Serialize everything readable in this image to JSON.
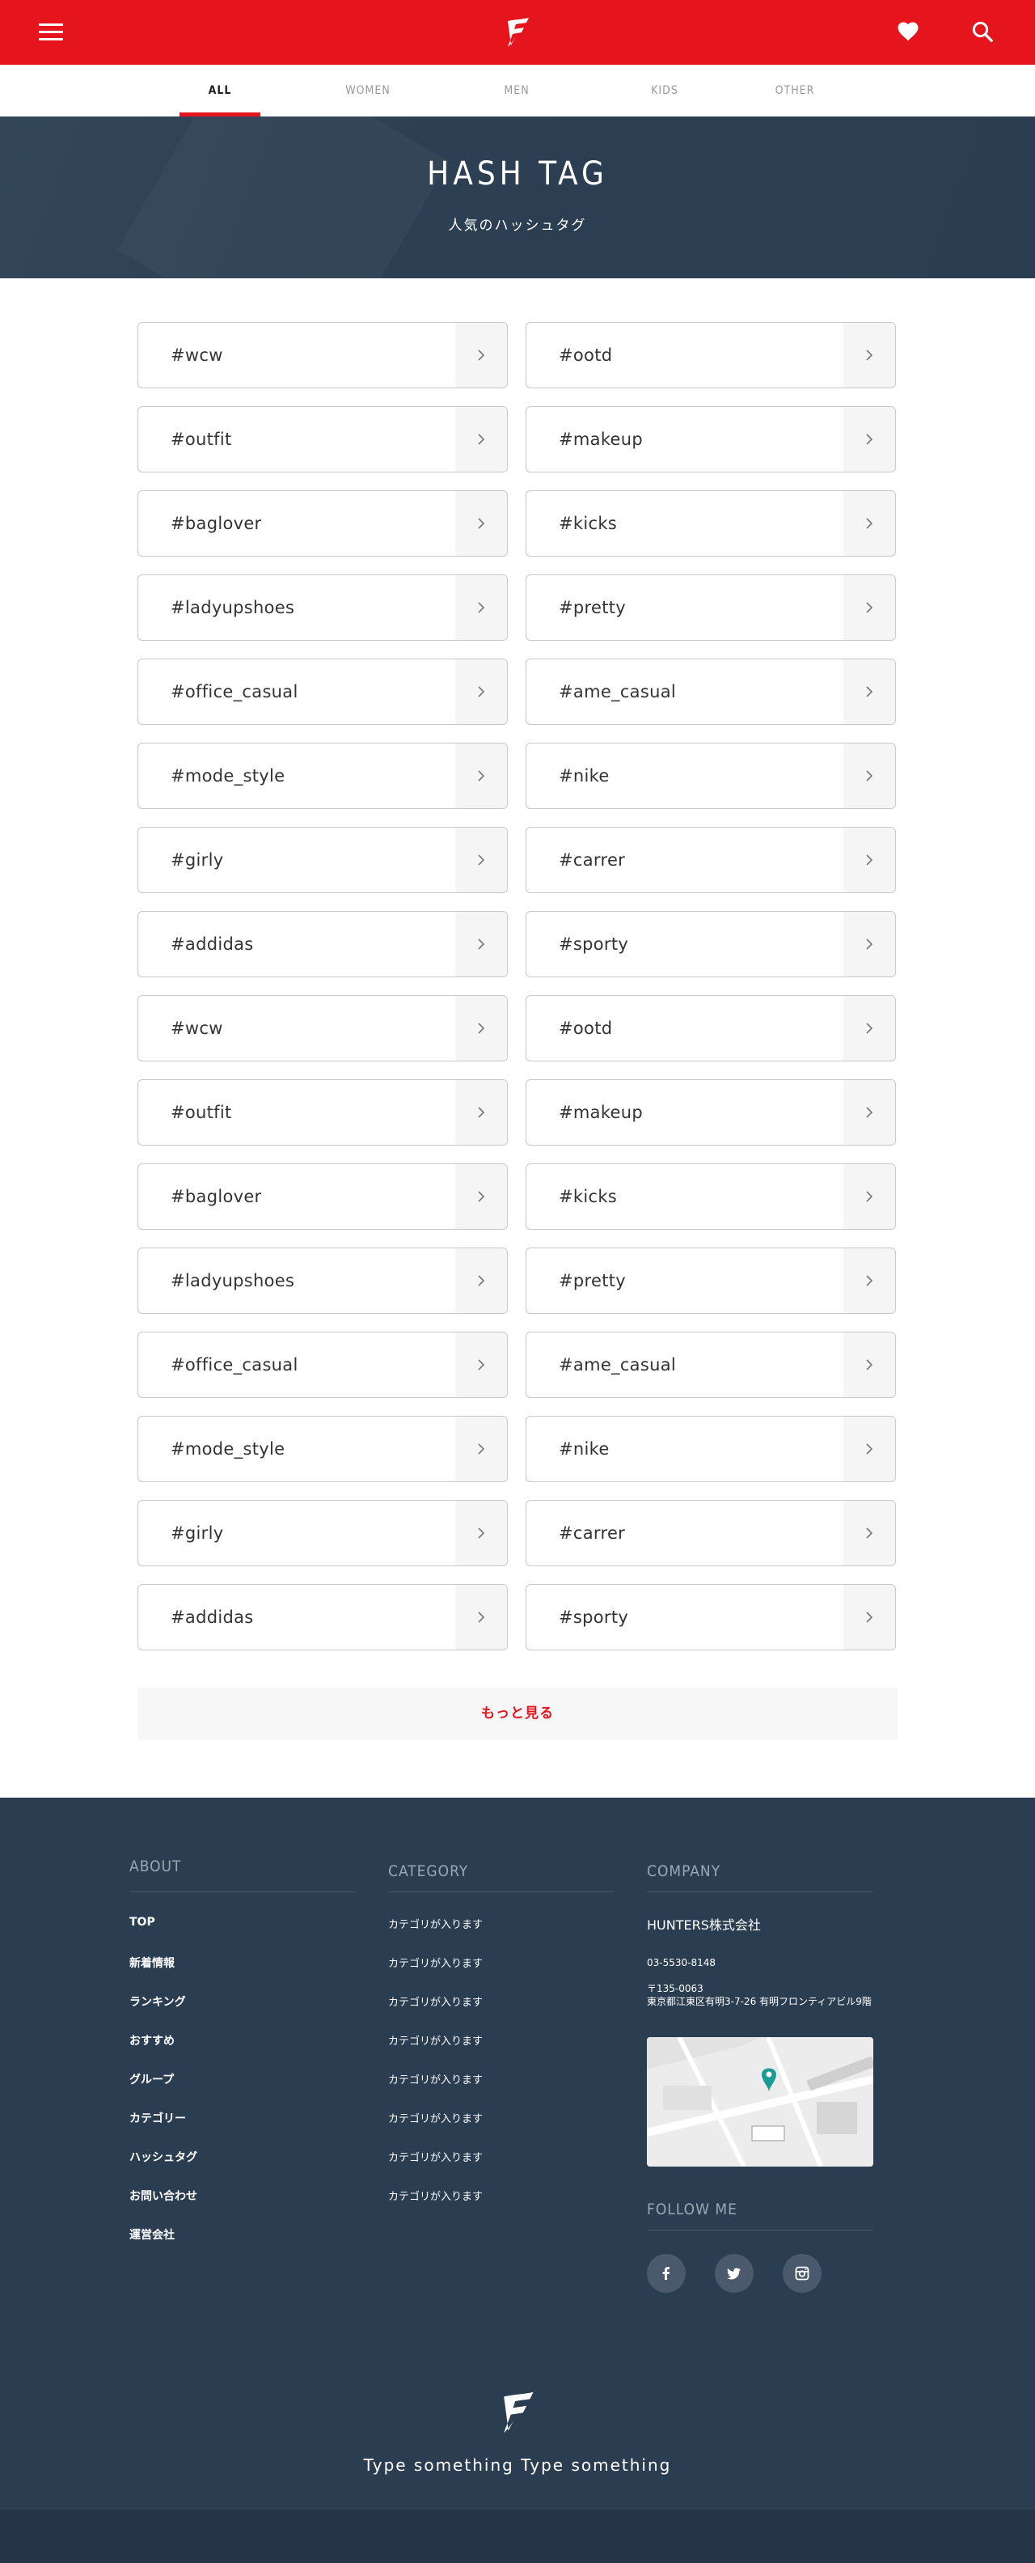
{
  "header": {
    "menu_icon": "hamburger-menu-icon",
    "logo_icon": "brand-logo-icon",
    "favorite_icon": "heart-icon",
    "search_icon": "search-icon",
    "brand_color": "#e5141d"
  },
  "tabs": [
    {
      "label": "ALL",
      "active": true
    },
    {
      "label": "WOMEN",
      "active": false
    },
    {
      "label": "MEN",
      "active": false
    },
    {
      "label": "KIDS",
      "active": false
    },
    {
      "label": "OTHER",
      "active": false
    }
  ],
  "hero": {
    "title": "HASH TAG",
    "subtitle": "人気のハッシュタグ"
  },
  "hashtags": [
    "#wcw",
    "#ootd",
    "#outfit",
    "#makeup",
    "#baglover",
    "#kicks",
    "#ladyupshoes",
    "#pretty",
    "#office_casual",
    "#ame_casual",
    "#mode_style",
    "#nike",
    "#girly",
    "#carrer",
    "#addidas",
    "#sporty",
    "#wcw",
    "#ootd",
    "#outfit",
    "#makeup",
    "#baglover",
    "#kicks",
    "#ladyupshoes",
    "#pretty",
    "#office_casual",
    "#ame_casual",
    "#mode_style",
    "#nike",
    "#girly",
    "#carrer",
    "#addidas",
    "#sporty"
  ],
  "more_button": "もっと見る",
  "footer": {
    "about": {
      "heading": "ABOUT",
      "links": [
        "TOP",
        "新着情報",
        "ランキング",
        "おすすめ",
        "グループ",
        "カテゴリー",
        "ハッシュタグ",
        "お問い合わせ",
        "運営会社"
      ]
    },
    "category": {
      "heading": "CATEGORY",
      "links": [
        "カテゴリが入ります",
        "カテゴリが入ります",
        "カテゴリが入ります",
        "カテゴリが入ります",
        "カテゴリが入ります",
        "カテゴリが入ります",
        "カテゴリが入ります",
        "カテゴリが入ります"
      ]
    },
    "company": {
      "heading": "COMPANY",
      "name": "HUNTERS株式会社",
      "phone": "03-5530-8148",
      "postal": "〒135-0063",
      "address": "東京都江東区有明3-7-26 有明フロンティアビル9階",
      "map_icon": "map-pin-icon"
    },
    "follow": {
      "heading": "FOLLOW ME",
      "icons": [
        "facebook-icon",
        "twitter-icon",
        "instagram-icon"
      ]
    },
    "tagline": "Type something Type something",
    "background": "#2b3d51"
  }
}
